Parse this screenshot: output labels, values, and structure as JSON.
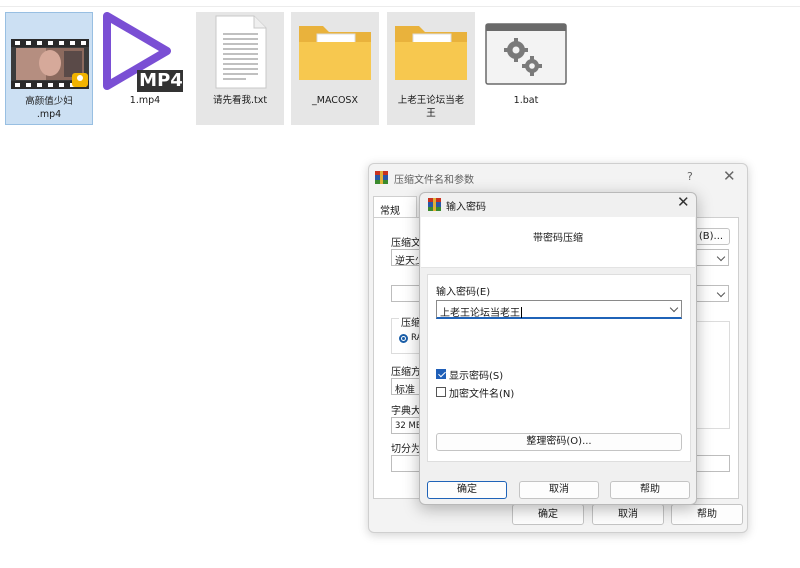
{
  "desktop": {
    "files": [
      {
        "name_line1": "高颜值少妇",
        "name_line2": ".mp4",
        "icon": "video-thumbnail-icon"
      },
      {
        "name_line1": "1.mp4",
        "name_line2": "",
        "icon": "mp4-play-icon",
        "badge": "MP4"
      },
      {
        "name_line1": "请先看我.txt",
        "name_line2": "",
        "icon": "text-document-icon"
      },
      {
        "name_line1": "_MACOSX",
        "name_line2": "",
        "icon": "folder-icon"
      },
      {
        "name_line1": "上老王论坛当老",
        "name_line2": "王",
        "icon": "folder-icon"
      },
      {
        "name_line1": "1.bat",
        "name_line2": "",
        "icon": "batch-gears-icon"
      }
    ]
  },
  "rar_window": {
    "title": "压缩文件名和参数",
    "help_glyph": "?",
    "close_glyph": "✕",
    "tab_general": "常规",
    "archive_name_label": "压缩文",
    "archive_name_value": "逆天少",
    "browse_button": "(B)...",
    "format_group_label": "压缩",
    "format_radio_label": "RA",
    "method_label": "压缩方",
    "method_value": "标准",
    "dict_label": "字典大",
    "dict_value": "32 MB",
    "split_label": "切分为",
    "ok_button": "确定",
    "cancel_button": "取消",
    "help_button": "帮助"
  },
  "password_dialog": {
    "title": "输入密码",
    "close_glyph": "✕",
    "heading": "带密码压缩",
    "password_label": "输入密码(E)",
    "password_value": "上老王论坛当老王",
    "show_password_label": "显示密码(S)",
    "show_password_checked": true,
    "encrypt_names_label": "加密文件名(N)",
    "encrypt_names_checked": false,
    "organize_button": "整理密码(O)...",
    "ok_button": "确定",
    "cancel_button": "取消",
    "help_button": "帮助"
  },
  "colors": {
    "accent": "#1f63b8",
    "selection": "#cce0f3",
    "folder": "#f7c84f",
    "play_triangle": "#7a4fd4"
  }
}
